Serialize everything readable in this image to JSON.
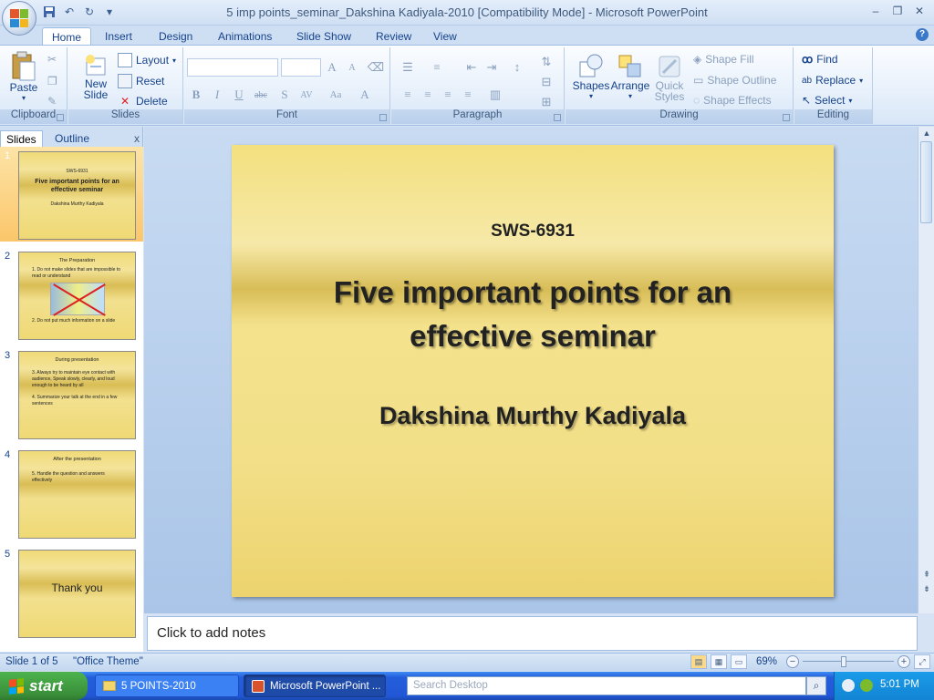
{
  "window": {
    "title": "5 imp points_seminar_Dakshina Kadiyala-2010 [Compatibility Mode] - Microsoft PowerPoint"
  },
  "quick_access": {
    "icons": [
      "save-icon",
      "undo-icon",
      "redo-icon",
      "customize-icon"
    ]
  },
  "ribbon": {
    "tabs": [
      {
        "label": "Home",
        "active": true
      },
      {
        "label": "Insert"
      },
      {
        "label": "Design"
      },
      {
        "label": "Animations"
      },
      {
        "label": "Slide Show"
      },
      {
        "label": "Review"
      },
      {
        "label": "View"
      }
    ],
    "clipboard": {
      "label": "Clipboard",
      "paste": "Paste"
    },
    "slides": {
      "label": "Slides",
      "new_slide_1": "New",
      "new_slide_2": "Slide",
      "layout": "Layout",
      "reset": "Reset",
      "delete": "Delete"
    },
    "font": {
      "label": "Font",
      "family_value": "",
      "size_value": "",
      "bold": "B",
      "italic": "I",
      "underline": "U",
      "strike": "abc",
      "shadow": "S",
      "spacing": "AV",
      "case": "Aa",
      "color": "A",
      "grow": "A",
      "shrink": "A"
    },
    "paragraph": {
      "label": "Paragraph"
    },
    "drawing": {
      "label": "Drawing",
      "shapes": "Shapes",
      "arrange": "Arrange",
      "quick_styles_1": "Quick",
      "quick_styles_2": "Styles",
      "shape_fill": "Shape Fill",
      "shape_outline": "Shape Outline",
      "shape_effects": "Shape Effects"
    },
    "editing": {
      "label": "Editing",
      "find": "Find",
      "replace": "Replace",
      "select": "Select"
    }
  },
  "left_pane": {
    "tabs": [
      "Slides",
      "Outline"
    ],
    "close": "x",
    "slides": [
      {
        "num": "1",
        "small": "SWS-6931",
        "title": "Five important points for an effective seminar",
        "sub": "Dakshina Murthy Kadiyala"
      },
      {
        "num": "2",
        "head": "The Preparation",
        "body1": "1.   Do not make slides  that are impossible to read  or understand",
        "body2": "2. Do not put  much information  on a slide"
      },
      {
        "num": "3",
        "head": "During presentation",
        "body1": "3. Always  try  to maintain  eye contact with audience,  Speak slowly,  clearly, and loud  enough  to be heard  by all",
        "body2": "4. Summarize  your  talk at the  end in a few sentences"
      },
      {
        "num": "4",
        "head": "After the presentation",
        "body1": "5. Handle  the question  and answers effectively"
      },
      {
        "num": "5",
        "big": "Thank you"
      }
    ]
  },
  "slide": {
    "code": "SWS-6931",
    "title": "Five important points for an effective seminar",
    "author": "Dakshina Murthy Kadiyala"
  },
  "notes": {
    "placeholder": "Click to add notes"
  },
  "status": {
    "slide_info": "Slide 1 of 5",
    "theme": "\"Office Theme\"",
    "zoom": "69%",
    "zoom_fraction": 0.45
  },
  "taskbar": {
    "start": "start",
    "tasks": [
      "5 POINTS-2010",
      "Microsoft PowerPoint ..."
    ],
    "search_placeholder": "Search Desktop",
    "clock": "5:01 PM"
  },
  "colors": {
    "ribbon_text": "#15428b",
    "slide_gold": "#f2df88",
    "taskbar_blue": "#245edb",
    "start_green": "#3a8f3a"
  }
}
